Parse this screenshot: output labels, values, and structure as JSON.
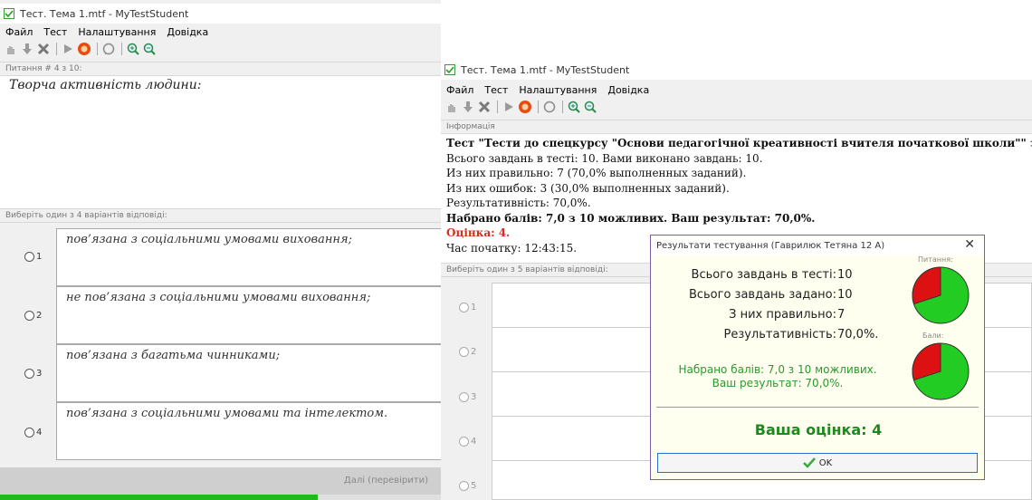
{
  "left_window": {
    "title": "Тест. Тема 1.mtf - MyTestStudent",
    "menu": [
      "Файл",
      "Тест",
      "Налаштування",
      "Довідка"
    ],
    "question_header": "Питання # 4 з 10:",
    "question_text": "Творча активність людини:",
    "answers_header": "Виберіть один з 4 варіантів відповіді:",
    "answers": [
      {
        "num": "1",
        "text": "пов’язана з соціальними умовами виховання;"
      },
      {
        "num": "2",
        "text": "не пов’язана з соціальними умовами виховання;"
      },
      {
        "num": "3",
        "text": "пов’язана  з багатьма чинниками;"
      },
      {
        "num": "4",
        "text": "пов’язана з соціальними умовами та інтелектом."
      }
    ],
    "next_button": "Далі (перевірити)",
    "progress": 0.72
  },
  "right_window": {
    "title": "Тест. Тема 1.mtf - MyTestStudent",
    "menu": [
      "Файл",
      "Тест",
      "Налаштування",
      "Довідка"
    ],
    "info_header": "Інформація",
    "info_lines": {
      "l1": "Тест \"Тести до спецкурсу \"Основи педагогічної креативності вчителя початкової школи\"\" закінчено...",
      "l2": "Всього завдань в тесті: 10. Вами виконано завдань: 10.",
      "l3": "Из них правильно: 7 (70,0% выполненных заданий).",
      "l4": "Из них ошибок: 3 (30,0% выполненных заданий).",
      "l5": "Результативність: 70,0%.",
      "l6": "Набрано балів: 7,0 з 10 можливих. Ваш результат: 70,0%.",
      "l7": "Оцінка: 4.",
      "l8": "Час початку: 12:43:15."
    },
    "answers_header": "Виберіть один з 5 варіантів відповіді:",
    "answer_numbers": [
      "1",
      "2",
      "3",
      "4",
      "5"
    ]
  },
  "dialog": {
    "title": "Результати тестування (Гаврилюк Тетяна 12 А)",
    "close": "✕",
    "stats": [
      {
        "label": "Всього завдань в тесті:",
        "value": "10"
      },
      {
        "label": "Всього завдань задано:",
        "value": "10"
      },
      {
        "label": "З них правильно:",
        "value": "7"
      },
      {
        "label": "Результативність:",
        "value": "70,0%."
      }
    ],
    "score_line1": "Набрано балів: 7,0 з 10 можливих.",
    "score_line2": "Ваш результат: 70,0%.",
    "pie1_label": "Питання:",
    "pie2_label": "Бали:",
    "pie_correct_fraction": 0.7,
    "grade": "Ваша оцінка: 4",
    "ok": "OK",
    "colors": {
      "correct": "#22cc22",
      "wrong": "#dd1111"
    }
  }
}
